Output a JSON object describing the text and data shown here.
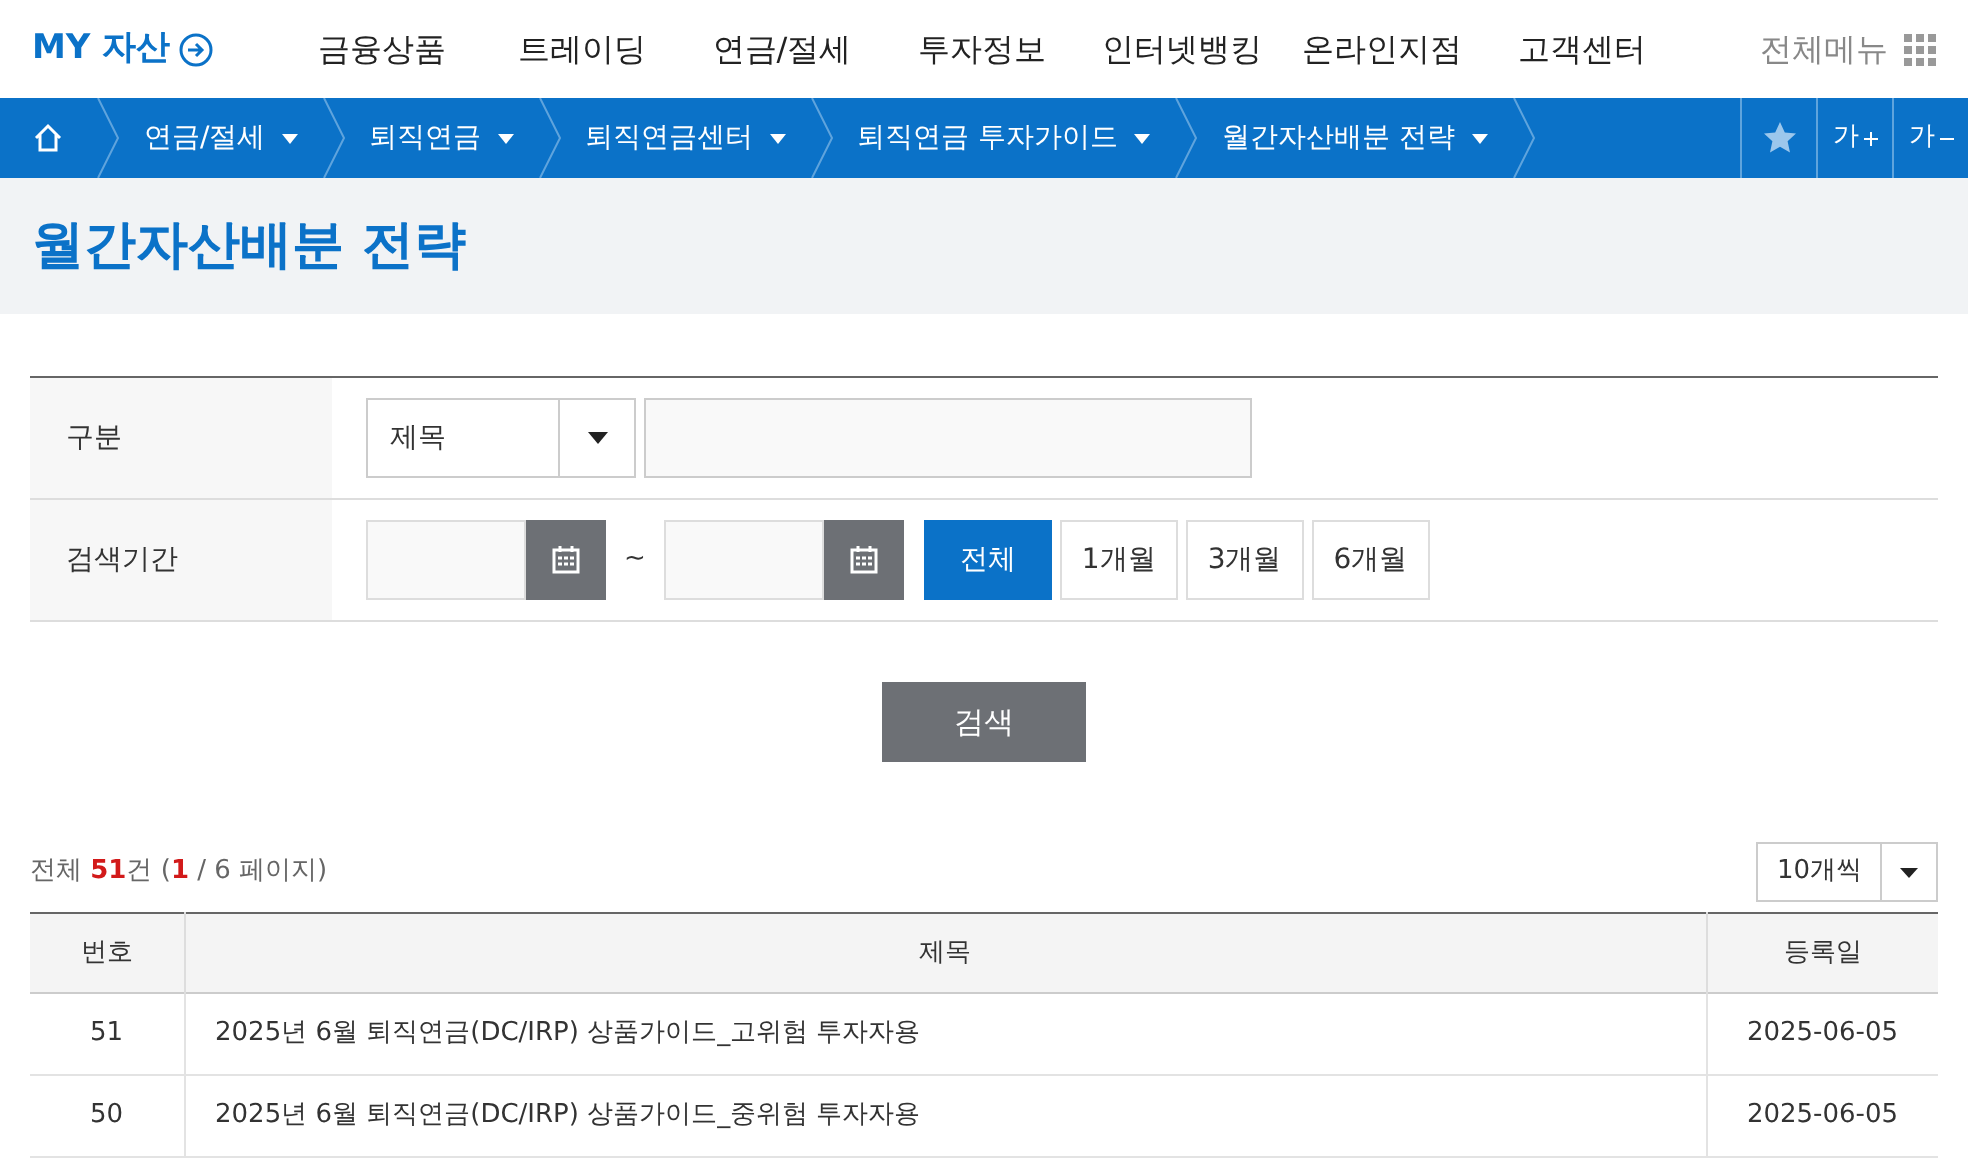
{
  "header": {
    "logo": "MY 자산",
    "nav": [
      "금융상품",
      "트레이딩",
      "연금/절세",
      "투자정보",
      "인터넷뱅킹",
      "온라인지점",
      "고객센터"
    ],
    "all_menu": "전체메뉴"
  },
  "breadcrumb": [
    "연금/절세",
    "퇴직연금",
    "퇴직연금센터",
    "퇴직연금 투자가이드",
    "월간자산배분 전략"
  ],
  "font_buttons": [
    "가",
    "가"
  ],
  "page_title": "월간자산배분 전략",
  "search": {
    "type_label": "구분",
    "type_value": "제목",
    "period_label": "검색기간",
    "tilde": "~",
    "periods": [
      {
        "label": "전체",
        "selected": true
      },
      {
        "label": "1개월",
        "selected": false
      },
      {
        "label": "3개월",
        "selected": false
      },
      {
        "label": "6개월",
        "selected": false
      }
    ],
    "button": "검색"
  },
  "summary": "전체 **51**건 (**1** / 6 페이지)",
  "page_size": "10개씩",
  "table": {
    "columns": [
      "번호",
      "제목",
      "등록일"
    ],
    "rows": [
      {
        "no": "51",
        "title": "2025년 6월 퇴직연금(DC/IRP) 상품가이드_고위험 투자자용",
        "date": "2025-06-05"
      },
      {
        "no": "50",
        "title": "2025년 6월 퇴직연금(DC/IRP) 상품가이드_중위험 투자자용",
        "date": "2025-06-05"
      }
    ]
  }
}
